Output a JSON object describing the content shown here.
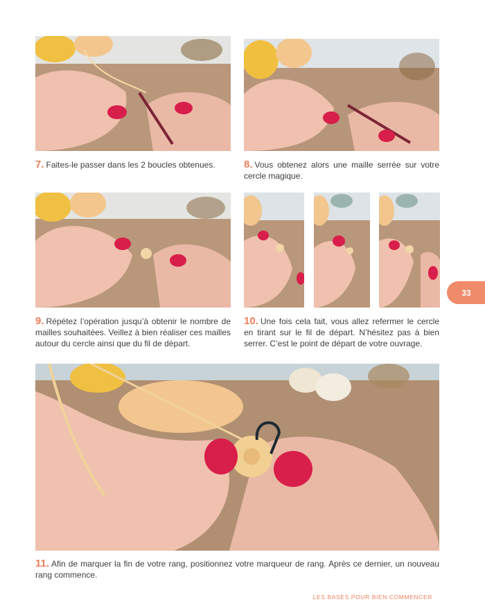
{
  "captions": [
    {
      "num": "7.",
      "text": "Faites-le passer dans les 2 boucles obtenues."
    },
    {
      "num": "8.",
      "text": "Vous obtenez alors une maille serrée sur votre cercle magique."
    },
    {
      "num": "9.",
      "text": "Répétez l’opération jusqu’à obtenir le nombre de mailles souhaitées. Veillez à bien réaliser ces mailles autour du cercle ainsi que du fil de départ."
    },
    {
      "num": "10.",
      "text": "Une fois cela fait, vous allez refermer le cercle en tirant sur le fil de départ. N’hésitez pas à bien serrer. C’est le point de départ de votre ouvrage."
    },
    {
      "num": "11.",
      "text": "Afin de marquer la fin de votre rang, positionnez votre marqueur de rang. Après ce dernier, un nouveau rang commence."
    }
  ],
  "page_number": "33",
  "footer": "LES BASES POUR BIEN COMMENCER",
  "colors": {
    "accent": "#ef8a6a",
    "nail": "#d81e4a",
    "skin": "#efc2b0",
    "yarn_yellow": "#f1c24a",
    "yarn_peach": "#f3c690"
  }
}
